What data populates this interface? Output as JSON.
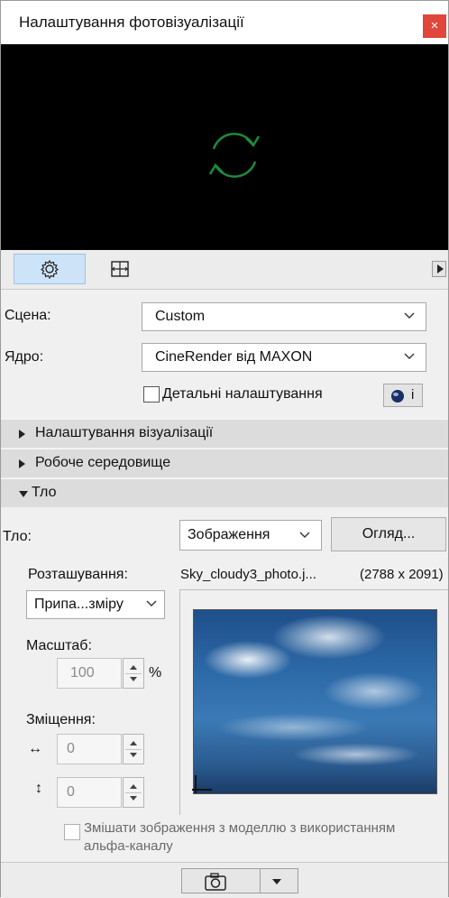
{
  "window": {
    "title": "Налаштування фотовізуалізації",
    "close_symbol": "×"
  },
  "preview": {
    "spinner_icon": "refresh-icon",
    "spinner_color": "#1e8a3e"
  },
  "toolbar": {
    "settings_icon": "gear-icon",
    "size_icon": "frame-size-icon",
    "expand_icon": "triangle-right-icon"
  },
  "scene": {
    "label": "Сцена:",
    "value": "Custom"
  },
  "engine": {
    "label": "Ядро:",
    "value": "CineRender від MAXON",
    "detailed_label": "Детальні налаштування",
    "detailed_checked": false,
    "info_symbol": "i"
  },
  "sections": [
    {
      "label": "Налаштування візуалізації",
      "expanded": false
    },
    {
      "label": "Робоче середовище",
      "expanded": false
    },
    {
      "label": "Тло",
      "expanded": true
    }
  ],
  "background": {
    "label": "Тло:",
    "type_value": "Зображення",
    "browse_label": "Огляд...",
    "placement_label": "Розташування:",
    "file_name": "Sky_cloudy3_photo.j...",
    "file_size": "(2788 x 2091)",
    "placement_value": "Припа...зміру",
    "scale_label": "Масштаб:",
    "scale_value": "100",
    "scale_unit": "%",
    "offset_label": "Зміщення:",
    "offset_h_symbol": "↔",
    "offset_h_value": "0",
    "offset_v_symbol": "↕",
    "offset_v_value": "0",
    "alpha_label_line1": "Змішати зображення з моделлю з використанням",
    "alpha_label_line2": "альфа-каналу",
    "alpha_checked": false
  },
  "bottom": {
    "camera_icon": "camera-icon"
  }
}
